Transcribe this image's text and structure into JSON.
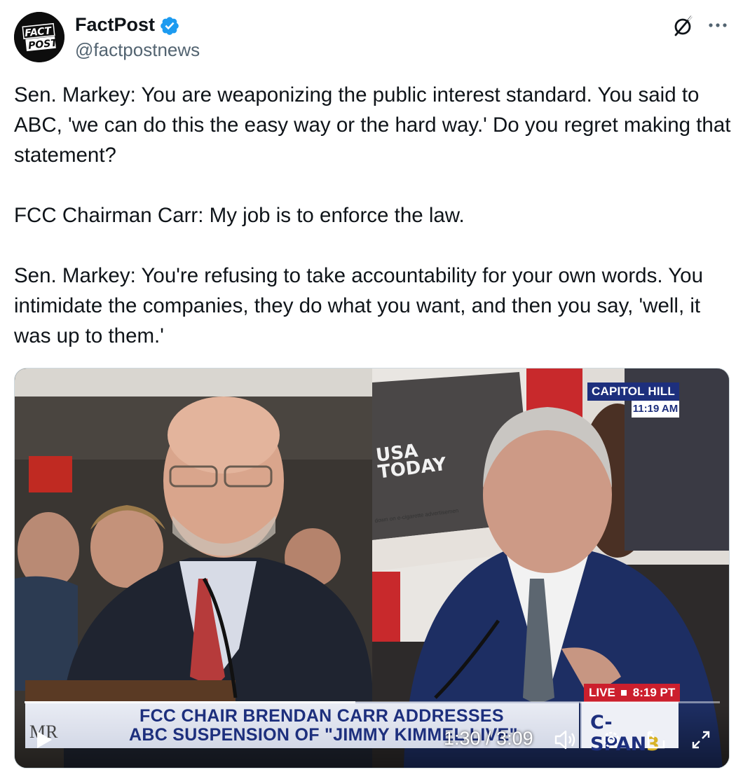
{
  "author": {
    "name": "FactPost",
    "handle": "@factpostnews",
    "verified": true,
    "avatar_text_top": "FACT",
    "avatar_text_bottom": "POST"
  },
  "header_actions": {
    "grok_icon": "grok-slash-circle-icon",
    "more_icon": "more-dots-icon"
  },
  "post": {
    "paragraphs": [
      "Sen. Markey: You are weaponizing the public interest standard. You said to ABC, 'we can do this the easy way or the hard way.' Do you regret making that statement?",
      "FCC Chairman Carr: My job is to enforce the law.",
      "Sen. Markey: You're refusing to take accountability for your own words. You intimidate the companies, they do what you want, and then you say, 'well, it was up to them.'"
    ]
  },
  "video": {
    "location": "CAPITOL HILL",
    "local_time": "11:19 AM",
    "live_label": "LIVE",
    "live_time": "8:19 PT",
    "lower_third_left": "MR",
    "headline_line1": "FCC CHAIR BRENDAN CARR ADDRESSES",
    "headline_line2": "ABC SUSPENSION OF \"JIMMY KIMMEL LIVE\"",
    "network_logo_main": "C-SPAN",
    "network_logo_number": "3",
    "background_sign": "USA\nTODAY",
    "background_caption": "down on e-cigarette advertisemen",
    "current_time": "1:30",
    "duration": "3:09",
    "time_display": "1:30 / 3:09",
    "progress_fraction": 0.476,
    "controls": [
      "play-icon",
      "volume-icon",
      "settings-icon",
      "picture-in-picture-icon",
      "fullscreen-icon"
    ]
  },
  "colors": {
    "verified_blue": "#1d9bf0",
    "cspan_blue": "#1d2f7d",
    "live_red": "#cc1f2d",
    "handle_gray": "#536471"
  }
}
